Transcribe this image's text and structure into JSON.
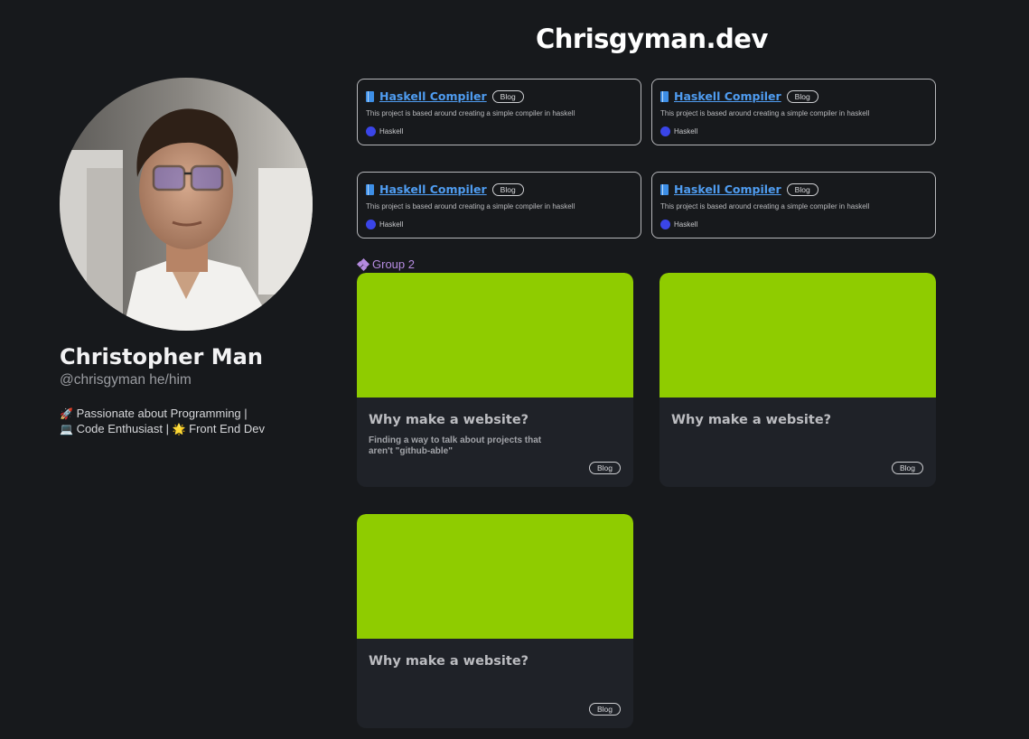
{
  "site": {
    "title": "Chrisgyman.dev"
  },
  "profile": {
    "name": "Christopher Man",
    "handle": "@chrisgyman he/him",
    "bio": {
      "rocket": "🚀",
      "line1": " Passionate about Programming |",
      "laptop": "💻",
      "line2a": " Code Enthusiast | ",
      "sparkle": "🌟",
      "line2b": " Front End Dev"
    }
  },
  "repos": [
    {
      "title": "Haskell Compiler",
      "tag": "Blog",
      "description": "This project is based around creating a simple compiler in haskell",
      "language": "Haskell"
    },
    {
      "title": "Haskell Compiler",
      "tag": "Blog",
      "description": "This project is based around creating a simple compiler in haskell",
      "language": "Haskell"
    },
    {
      "title": "Haskell Compiler",
      "tag": "Blog",
      "description": "This project is based around creating a simple compiler in haskell",
      "language": "Haskell"
    },
    {
      "title": "Haskell Compiler",
      "tag": "Blog",
      "description": "This project is based around creating a simple compiler in haskell",
      "language": "Haskell"
    }
  ],
  "group": {
    "label": "Group 2"
  },
  "posts": [
    {
      "title": "Why make a website?",
      "description": "Finding a way to talk about projects that aren't \"github-able\"",
      "tag": "Blog"
    },
    {
      "title": "Why make a website?",
      "description": "",
      "tag": "Blog"
    },
    {
      "title": "Why make a website?",
      "description": "",
      "tag": "Blog"
    }
  ],
  "colors": {
    "background": "#17191c",
    "link": "#4f9cf0",
    "cover": "#8fcc00",
    "language_dot": "#3a45e8",
    "group_accent": "#b58be0"
  }
}
